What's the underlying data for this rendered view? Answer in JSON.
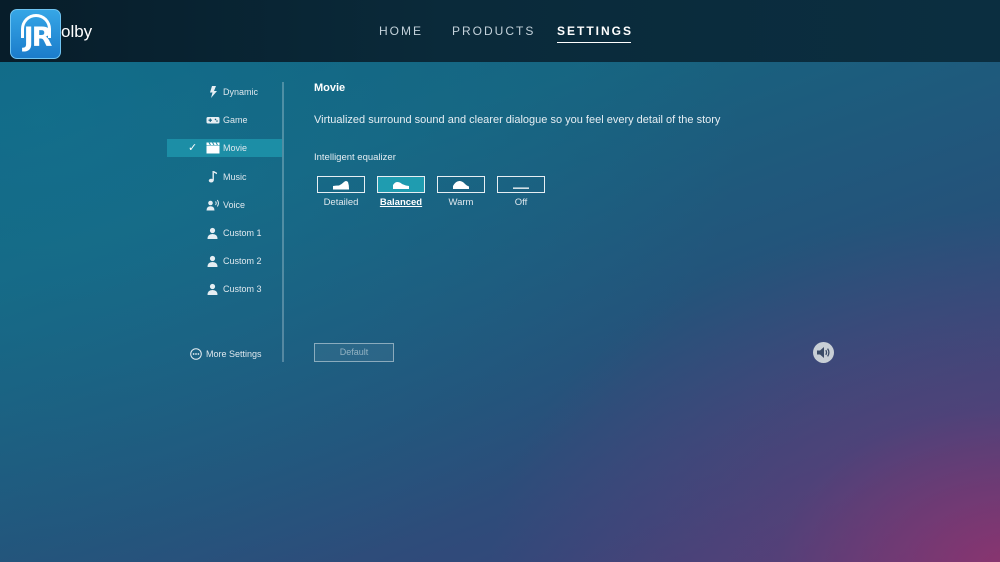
{
  "brand": {
    "logo_text": "JR",
    "wordmark": "olby"
  },
  "nav": {
    "items": [
      "HOME",
      "PRODUCTS",
      "SETTINGS"
    ],
    "active": "SETTINGS"
  },
  "sidebar": {
    "items": [
      {
        "label": "Dynamic",
        "icon": "lightning-icon"
      },
      {
        "label": "Game",
        "icon": "gamepad-icon"
      },
      {
        "label": "Movie",
        "icon": "clapperboard-icon",
        "active": true
      },
      {
        "label": "Music",
        "icon": "music-note-icon"
      },
      {
        "label": "Voice",
        "icon": "speaking-person-icon"
      },
      {
        "label": "Custom 1",
        "icon": "person-icon"
      },
      {
        "label": "Custom 2",
        "icon": "person-icon"
      },
      {
        "label": "Custom 3",
        "icon": "person-icon"
      }
    ],
    "more_settings": "More Settings"
  },
  "content": {
    "title": "Movie",
    "description": "Virtualized surround sound and clearer dialogue so you feel every detail of the story",
    "equalizer": {
      "label": "Intelligent equalizer",
      "options": [
        "Detailed",
        "Balanced",
        "Warm",
        "Off"
      ],
      "selected": "Balanced"
    },
    "default_button": "Default"
  },
  "colors": {
    "accent": "#1c8ea6",
    "topbar": "#0a2a3a",
    "background_start": "#0c5f7c",
    "background_end": "#4a3f78"
  },
  "icons": {
    "volume": "speaker-volume-icon",
    "check": "checkmark-icon"
  }
}
